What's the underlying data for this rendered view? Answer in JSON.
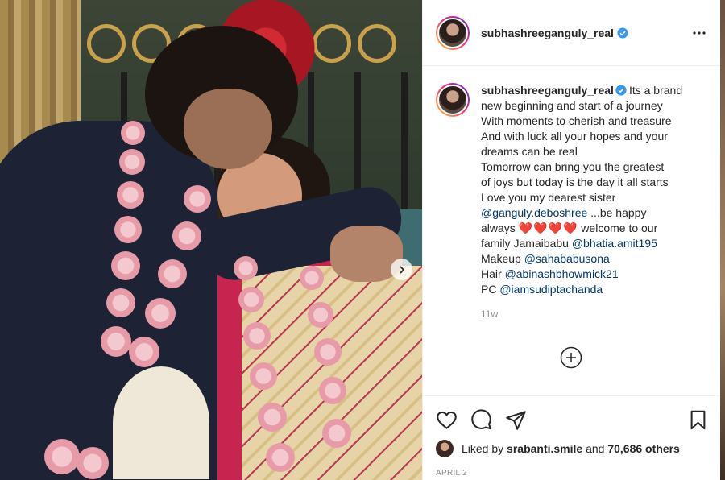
{
  "post": {
    "author": "subhashreeganguly_real",
    "verified": true,
    "more_icon": "more-options-icon"
  },
  "caption": {
    "username": "subhashreeganguly_real",
    "lines": [
      "Its a brand",
      "new beginning and start of a journey",
      "With moments to cherish and treasure",
      "And with luck all your hopes and your",
      "dreams can be real",
      "Tomorrow can bring you the greatest",
      "of joys but today is the day it all starts",
      "Love you my dearest sister"
    ],
    "mention1": "@ganguly.deboshree",
    "be_happy": " ...be happy",
    "always": "always ",
    "hearts": "❤️❤️❤️❤️",
    "welcome": " welcome to our",
    "family_prefix": "family Jamaibabu ",
    "mention2": "@bhatia.amit195",
    "makeup_prefix": "Makeup ",
    "mention3": "@sahababusona",
    "hair_prefix": "Hair ",
    "mention4": "@abinashbhowmick21",
    "pc_prefix": "PC ",
    "mention5": "@iamsudiptachanda",
    "time": "11w"
  },
  "likes": {
    "prefix": "Liked by ",
    "user": "srabanti.smile",
    "and": " and ",
    "count": "70,686 others"
  },
  "date": "APRIL 2",
  "colors": {
    "verified": "#3897f0",
    "link": "#00376b",
    "heart": "#ed4956",
    "muted": "#8e8e8e"
  }
}
